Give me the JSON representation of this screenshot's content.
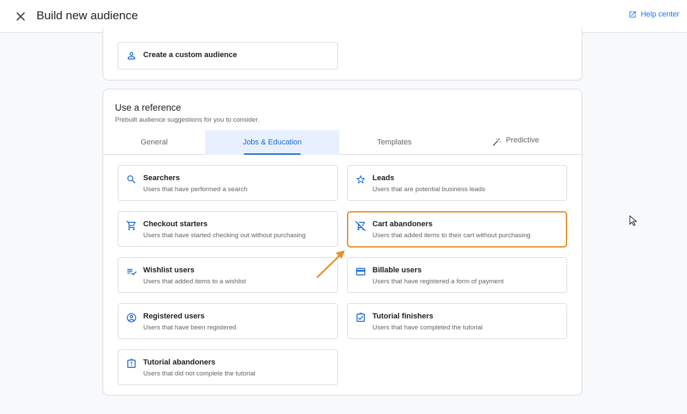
{
  "header": {
    "title": "Build new audience",
    "help_label": "Help center",
    "close_icon": "close-icon",
    "help_icon": "open-in-new-icon"
  },
  "custom_audience": {
    "label": "Create a custom audience",
    "icon": "person-icon"
  },
  "reference": {
    "heading": "Use a reference",
    "subheading": "Prebuilt audience suggestions for you to consider.",
    "tabs": [
      {
        "label": "General",
        "active": false
      },
      {
        "label": "Jobs & Education",
        "active": true
      },
      {
        "label": "Templates",
        "active": false
      },
      {
        "label": "Predictive",
        "active": false,
        "icon": "magic-wand-icon"
      }
    ],
    "options": [
      {
        "title": "Searchers",
        "desc": "Users that have performed a search",
        "icon": "search-icon"
      },
      {
        "title": "Leads",
        "desc": "Users that are potential business leads",
        "icon": "star-icon"
      },
      {
        "title": "Checkout starters",
        "desc": "Users that have started checking out without purchasing",
        "icon": "cart-icon"
      },
      {
        "title": "Cart abandoners",
        "desc": "Users that added items to their cart without purchasing",
        "icon": "remove-cart-icon",
        "highlighted": true
      },
      {
        "title": "Wishlist users",
        "desc": "Users that added items to a wishlist",
        "icon": "playlist-check-icon"
      },
      {
        "title": "Billable users",
        "desc": "Users that have registered a form of payment",
        "icon": "credit-card-icon"
      },
      {
        "title": "Registered users",
        "desc": "Users that have been registered",
        "icon": "account-circle-icon"
      },
      {
        "title": "Tutorial finishers",
        "desc": "Users that have completed the tutorial",
        "icon": "assignment-check-icon"
      },
      {
        "title": "Tutorial abandoners",
        "desc": "Users that did not complete the tutorial",
        "icon": "assignment-late-icon"
      }
    ]
  },
  "colors": {
    "accent": "#1a73e8",
    "icon_blue": "#1967d2",
    "highlight": "#e8912d",
    "tab_active_bg": "#e8f0fe"
  }
}
